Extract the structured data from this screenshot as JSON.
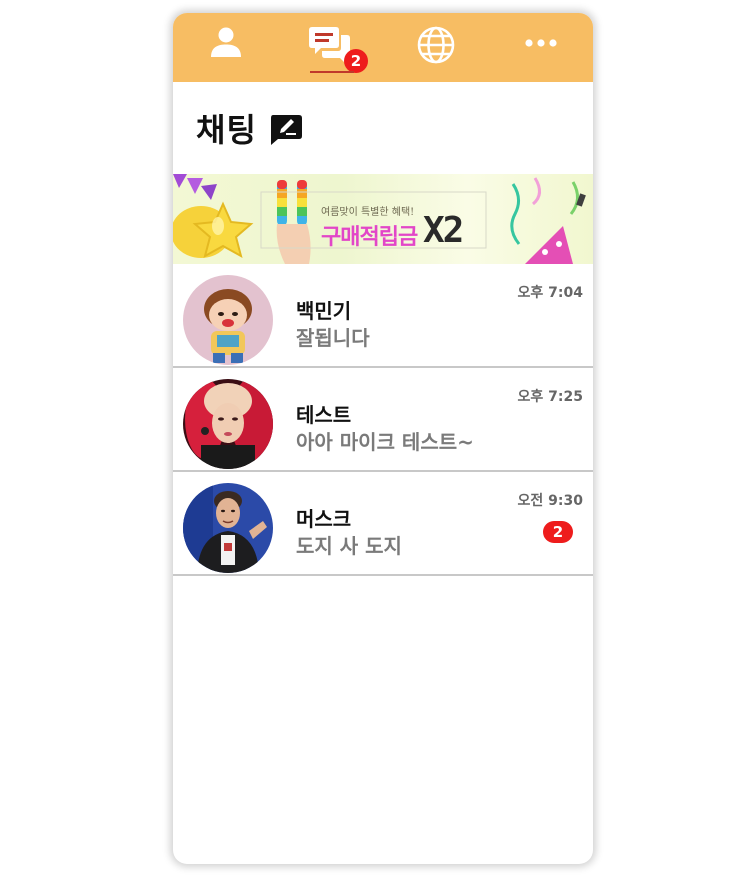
{
  "nav": {
    "tabs": [
      {
        "icon": "person-icon",
        "active": false
      },
      {
        "icon": "chat-bubbles-icon",
        "active": true,
        "badge": "2"
      },
      {
        "icon": "globe-icon",
        "active": false
      },
      {
        "icon": "more-dots-icon",
        "active": false
      }
    ],
    "accent_color": "#f7bd63",
    "badge_color": "#ee1c1c"
  },
  "header": {
    "title": "채팅",
    "compose_icon": "compose-icon"
  },
  "banner": {
    "subtitle": "여름맞이 특별한 혜택!",
    "headline": "구매적립금",
    "multiplier": "X2"
  },
  "chats": [
    {
      "name": "백민기",
      "message": "잘됩니다",
      "time": "오후 7:04",
      "unread": ""
    },
    {
      "name": "테스트",
      "message": "아아 마이크 테스트~",
      "time": "오후 7:25",
      "unread": ""
    },
    {
      "name": "머스크",
      "message": "도지 사 도지",
      "time": "오전 9:30",
      "unread": "2"
    }
  ]
}
